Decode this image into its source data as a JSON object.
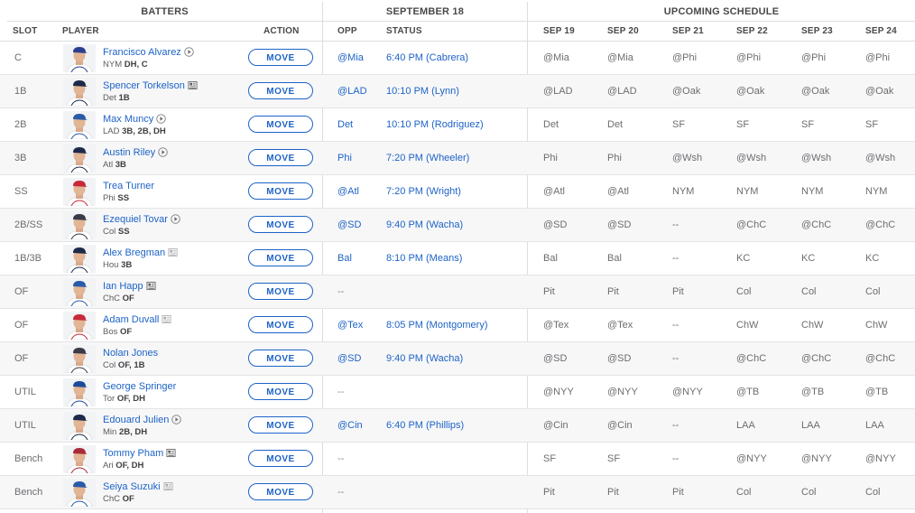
{
  "headers": {
    "batters": "BATTERS",
    "september": "SEPTEMBER 18",
    "upcoming": "UPCOMING SCHEDULE",
    "slot": "SLOT",
    "player": "PLAYER",
    "action": "ACTION",
    "opp": "OPP",
    "status": "STATUS",
    "dates": [
      "SEP 19",
      "SEP 20",
      "SEP 21",
      "SEP 22",
      "SEP 23",
      "SEP 24"
    ]
  },
  "move_label": "MOVE",
  "colors": {
    "link": "#1d63c6",
    "border": "#dcdddf",
    "alt_row": "#f7f7f8",
    "header_text": "#48494a"
  },
  "rows": [
    {
      "slot": "C",
      "name": "Francisco Alvarez",
      "team": "NYM",
      "pos": "DH, C",
      "icon": "play-circle-icon",
      "opp": "@Mia",
      "status": "6:40 PM (Cabrera)",
      "sched": [
        "@Mia",
        "@Mia",
        "@Phi",
        "@Phi",
        "@Phi",
        "@Phi"
      ],
      "jersey": "#2a3f8f"
    },
    {
      "slot": "1B",
      "name": "Spencer Torkelson",
      "team": "Det",
      "pos": "1B",
      "icon": "news-icon",
      "opp": "@LAD",
      "status": "10:10 PM (Lynn)",
      "sched": [
        "@LAD",
        "@LAD",
        "@Oak",
        "@Oak",
        "@Oak",
        "@Oak"
      ],
      "jersey": "#1d2a4a"
    },
    {
      "slot": "2B",
      "name": "Max Muncy",
      "team": "LAD",
      "pos": "3B, 2B, DH",
      "icon": "play-circle-icon",
      "opp": "Det",
      "status": "10:10 PM (Rodriguez)",
      "sched": [
        "Det",
        "Det",
        "SF",
        "SF",
        "SF",
        "SF"
      ],
      "jersey": "#2a5aa8"
    },
    {
      "slot": "3B",
      "name": "Austin Riley",
      "team": "Atl",
      "pos": "3B",
      "icon": "play-circle-icon",
      "opp": "Phi",
      "status": "7:20 PM (Wheeler)",
      "sched": [
        "Phi",
        "Phi",
        "@Wsh",
        "@Wsh",
        "@Wsh",
        "@Wsh"
      ],
      "jersey": "#1d2a4a"
    },
    {
      "slot": "SS",
      "name": "Trea Turner",
      "team": "Phi",
      "pos": "SS",
      "icon": "",
      "opp": "@Atl",
      "status": "7:20 PM (Wright)",
      "sched": [
        "@Atl",
        "@Atl",
        "NYM",
        "NYM",
        "NYM",
        "NYM"
      ],
      "jersey": "#c8283a"
    },
    {
      "slot": "2B/SS",
      "name": "Ezequiel Tovar",
      "team": "Col",
      "pos": "SS",
      "icon": "play-circle-icon",
      "opp": "@SD",
      "status": "9:40 PM (Wacha)",
      "sched": [
        "@SD",
        "@SD",
        "--",
        "@ChC",
        "@ChC",
        "@ChC"
      ],
      "jersey": "#3a3a4a"
    },
    {
      "slot": "1B/3B",
      "name": "Alex Bregman",
      "team": "Hou",
      "pos": "3B",
      "icon": "news-light-icon",
      "opp": "Bal",
      "status": "8:10 PM (Means)",
      "sched": [
        "Bal",
        "Bal",
        "--",
        "KC",
        "KC",
        "KC"
      ],
      "jersey": "#1d2a4a"
    },
    {
      "slot": "OF",
      "name": "Ian Happ",
      "team": "ChC",
      "pos": "OF",
      "icon": "news-icon",
      "opp": "--",
      "status": "",
      "sched": [
        "Pit",
        "Pit",
        "Pit",
        "Col",
        "Col",
        "Col"
      ],
      "jersey": "#2a5aa8"
    },
    {
      "slot": "OF",
      "name": "Adam Duvall",
      "team": "Bos",
      "pos": "OF",
      "icon": "news-light-icon",
      "opp": "@Tex",
      "status": "8:05 PM (Montgomery)",
      "sched": [
        "@Tex",
        "@Tex",
        "--",
        "ChW",
        "ChW",
        "ChW"
      ],
      "jersey": "#c8283a"
    },
    {
      "slot": "OF",
      "name": "Nolan Jones",
      "team": "Col",
      "pos": "OF, 1B",
      "icon": "",
      "opp": "@SD",
      "status": "9:40 PM (Wacha)",
      "sched": [
        "@SD",
        "@SD",
        "--",
        "@ChC",
        "@ChC",
        "@ChC"
      ],
      "jersey": "#3a3a4a"
    },
    {
      "slot": "UTIL",
      "name": "George Springer",
      "team": "Tor",
      "pos": "OF, DH",
      "icon": "",
      "opp": "--",
      "status": "",
      "sched": [
        "@NYY",
        "@NYY",
        "@NYY",
        "@TB",
        "@TB",
        "@TB"
      ],
      "jersey": "#1d4a9a"
    },
    {
      "slot": "UTIL",
      "name": "Edouard Julien",
      "team": "Min",
      "pos": "2B, DH",
      "icon": "play-circle-icon",
      "opp": "@Cin",
      "status": "6:40 PM (Phillips)",
      "sched": [
        "@Cin",
        "@Cin",
        "--",
        "LAA",
        "LAA",
        "LAA"
      ],
      "jersey": "#1d2a4a"
    },
    {
      "slot": "Bench",
      "name": "Tommy Pham",
      "team": "Ari",
      "pos": "OF, DH",
      "icon": "news-icon",
      "opp": "--",
      "status": "",
      "sched": [
        "SF",
        "SF",
        "--",
        "@NYY",
        "@NYY",
        "@NYY"
      ],
      "jersey": "#a82a3a"
    },
    {
      "slot": "Bench",
      "name": "Seiya Suzuki",
      "team": "ChC",
      "pos": "OF",
      "icon": "news-light-icon",
      "opp": "--",
      "status": "",
      "sched": [
        "Pit",
        "Pit",
        "Pit",
        "Col",
        "Col",
        "Col"
      ],
      "jersey": "#2a5aa8"
    }
  ]
}
